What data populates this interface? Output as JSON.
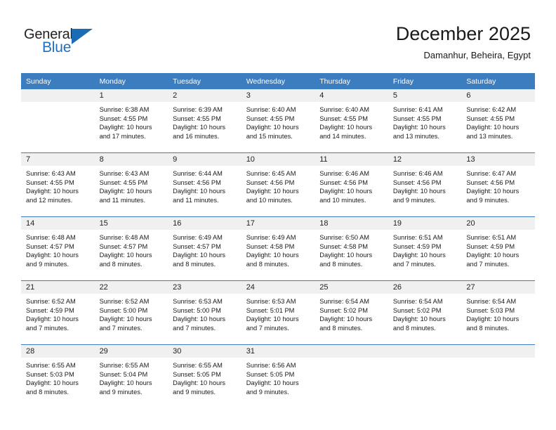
{
  "logo": {
    "word_top": "General",
    "word_bottom": "Blue",
    "accent_color": "#1a6cb5",
    "triangle_icon": "triangle-icon"
  },
  "header": {
    "title": "December 2025",
    "subtitle": "Damanhur, Beheira, Egypt"
  },
  "calendar": {
    "header_bg": "#3c7dc0",
    "daynum_bg": "#f0f0f0",
    "weekday_headers": [
      "Sunday",
      "Monday",
      "Tuesday",
      "Wednesday",
      "Thursday",
      "Friday",
      "Saturday"
    ],
    "weeks": [
      [
        {
          "day": "",
          "sunrise": "",
          "sunset": "",
          "daylight_line1": "",
          "daylight_line2": "",
          "empty": true
        },
        {
          "day": "1",
          "sunrise": "Sunrise: 6:38 AM",
          "sunset": "Sunset: 4:55 PM",
          "daylight_line1": "Daylight: 10 hours",
          "daylight_line2": "and 17 minutes.",
          "empty": false
        },
        {
          "day": "2",
          "sunrise": "Sunrise: 6:39 AM",
          "sunset": "Sunset: 4:55 PM",
          "daylight_line1": "Daylight: 10 hours",
          "daylight_line2": "and 16 minutes.",
          "empty": false
        },
        {
          "day": "3",
          "sunrise": "Sunrise: 6:40 AM",
          "sunset": "Sunset: 4:55 PM",
          "daylight_line1": "Daylight: 10 hours",
          "daylight_line2": "and 15 minutes.",
          "empty": false
        },
        {
          "day": "4",
          "sunrise": "Sunrise: 6:40 AM",
          "sunset": "Sunset: 4:55 PM",
          "daylight_line1": "Daylight: 10 hours",
          "daylight_line2": "and 14 minutes.",
          "empty": false
        },
        {
          "day": "5",
          "sunrise": "Sunrise: 6:41 AM",
          "sunset": "Sunset: 4:55 PM",
          "daylight_line1": "Daylight: 10 hours",
          "daylight_line2": "and 13 minutes.",
          "empty": false
        },
        {
          "day": "6",
          "sunrise": "Sunrise: 6:42 AM",
          "sunset": "Sunset: 4:55 PM",
          "daylight_line1": "Daylight: 10 hours",
          "daylight_line2": "and 13 minutes.",
          "empty": false
        }
      ],
      [
        {
          "day": "7",
          "sunrise": "Sunrise: 6:43 AM",
          "sunset": "Sunset: 4:55 PM",
          "daylight_line1": "Daylight: 10 hours",
          "daylight_line2": "and 12 minutes.",
          "empty": false
        },
        {
          "day": "8",
          "sunrise": "Sunrise: 6:43 AM",
          "sunset": "Sunset: 4:55 PM",
          "daylight_line1": "Daylight: 10 hours",
          "daylight_line2": "and 11 minutes.",
          "empty": false
        },
        {
          "day": "9",
          "sunrise": "Sunrise: 6:44 AM",
          "sunset": "Sunset: 4:56 PM",
          "daylight_line1": "Daylight: 10 hours",
          "daylight_line2": "and 11 minutes.",
          "empty": false
        },
        {
          "day": "10",
          "sunrise": "Sunrise: 6:45 AM",
          "sunset": "Sunset: 4:56 PM",
          "daylight_line1": "Daylight: 10 hours",
          "daylight_line2": "and 10 minutes.",
          "empty": false
        },
        {
          "day": "11",
          "sunrise": "Sunrise: 6:46 AM",
          "sunset": "Sunset: 4:56 PM",
          "daylight_line1": "Daylight: 10 hours",
          "daylight_line2": "and 10 minutes.",
          "empty": false
        },
        {
          "day": "12",
          "sunrise": "Sunrise: 6:46 AM",
          "sunset": "Sunset: 4:56 PM",
          "daylight_line1": "Daylight: 10 hours",
          "daylight_line2": "and 9 minutes.",
          "empty": false
        },
        {
          "day": "13",
          "sunrise": "Sunrise: 6:47 AM",
          "sunset": "Sunset: 4:56 PM",
          "daylight_line1": "Daylight: 10 hours",
          "daylight_line2": "and 9 minutes.",
          "empty": false
        }
      ],
      [
        {
          "day": "14",
          "sunrise": "Sunrise: 6:48 AM",
          "sunset": "Sunset: 4:57 PM",
          "daylight_line1": "Daylight: 10 hours",
          "daylight_line2": "and 9 minutes.",
          "empty": false
        },
        {
          "day": "15",
          "sunrise": "Sunrise: 6:48 AM",
          "sunset": "Sunset: 4:57 PM",
          "daylight_line1": "Daylight: 10 hours",
          "daylight_line2": "and 8 minutes.",
          "empty": false
        },
        {
          "day": "16",
          "sunrise": "Sunrise: 6:49 AM",
          "sunset": "Sunset: 4:57 PM",
          "daylight_line1": "Daylight: 10 hours",
          "daylight_line2": "and 8 minutes.",
          "empty": false
        },
        {
          "day": "17",
          "sunrise": "Sunrise: 6:49 AM",
          "sunset": "Sunset: 4:58 PM",
          "daylight_line1": "Daylight: 10 hours",
          "daylight_line2": "and 8 minutes.",
          "empty": false
        },
        {
          "day": "18",
          "sunrise": "Sunrise: 6:50 AM",
          "sunset": "Sunset: 4:58 PM",
          "daylight_line1": "Daylight: 10 hours",
          "daylight_line2": "and 8 minutes.",
          "empty": false
        },
        {
          "day": "19",
          "sunrise": "Sunrise: 6:51 AM",
          "sunset": "Sunset: 4:59 PM",
          "daylight_line1": "Daylight: 10 hours",
          "daylight_line2": "and 7 minutes.",
          "empty": false
        },
        {
          "day": "20",
          "sunrise": "Sunrise: 6:51 AM",
          "sunset": "Sunset: 4:59 PM",
          "daylight_line1": "Daylight: 10 hours",
          "daylight_line2": "and 7 minutes.",
          "empty": false
        }
      ],
      [
        {
          "day": "21",
          "sunrise": "Sunrise: 6:52 AM",
          "sunset": "Sunset: 4:59 PM",
          "daylight_line1": "Daylight: 10 hours",
          "daylight_line2": "and 7 minutes.",
          "empty": false
        },
        {
          "day": "22",
          "sunrise": "Sunrise: 6:52 AM",
          "sunset": "Sunset: 5:00 PM",
          "daylight_line1": "Daylight: 10 hours",
          "daylight_line2": "and 7 minutes.",
          "empty": false
        },
        {
          "day": "23",
          "sunrise": "Sunrise: 6:53 AM",
          "sunset": "Sunset: 5:00 PM",
          "daylight_line1": "Daylight: 10 hours",
          "daylight_line2": "and 7 minutes.",
          "empty": false
        },
        {
          "day": "24",
          "sunrise": "Sunrise: 6:53 AM",
          "sunset": "Sunset: 5:01 PM",
          "daylight_line1": "Daylight: 10 hours",
          "daylight_line2": "and 7 minutes.",
          "empty": false
        },
        {
          "day": "25",
          "sunrise": "Sunrise: 6:54 AM",
          "sunset": "Sunset: 5:02 PM",
          "daylight_line1": "Daylight: 10 hours",
          "daylight_line2": "and 8 minutes.",
          "empty": false
        },
        {
          "day": "26",
          "sunrise": "Sunrise: 6:54 AM",
          "sunset": "Sunset: 5:02 PM",
          "daylight_line1": "Daylight: 10 hours",
          "daylight_line2": "and 8 minutes.",
          "empty": false
        },
        {
          "day": "27",
          "sunrise": "Sunrise: 6:54 AM",
          "sunset": "Sunset: 5:03 PM",
          "daylight_line1": "Daylight: 10 hours",
          "daylight_line2": "and 8 minutes.",
          "empty": false
        }
      ],
      [
        {
          "day": "28",
          "sunrise": "Sunrise: 6:55 AM",
          "sunset": "Sunset: 5:03 PM",
          "daylight_line1": "Daylight: 10 hours",
          "daylight_line2": "and 8 minutes.",
          "empty": false
        },
        {
          "day": "29",
          "sunrise": "Sunrise: 6:55 AM",
          "sunset": "Sunset: 5:04 PM",
          "daylight_line1": "Daylight: 10 hours",
          "daylight_line2": "and 9 minutes.",
          "empty": false
        },
        {
          "day": "30",
          "sunrise": "Sunrise: 6:55 AM",
          "sunset": "Sunset: 5:05 PM",
          "daylight_line1": "Daylight: 10 hours",
          "daylight_line2": "and 9 minutes.",
          "empty": false
        },
        {
          "day": "31",
          "sunrise": "Sunrise: 6:56 AM",
          "sunset": "Sunset: 5:05 PM",
          "daylight_line1": "Daylight: 10 hours",
          "daylight_line2": "and 9 minutes.",
          "empty": false
        },
        {
          "day": "",
          "sunrise": "",
          "sunset": "",
          "daylight_line1": "",
          "daylight_line2": "",
          "empty": true
        },
        {
          "day": "",
          "sunrise": "",
          "sunset": "",
          "daylight_line1": "",
          "daylight_line2": "",
          "empty": true
        },
        {
          "day": "",
          "sunrise": "",
          "sunset": "",
          "daylight_line1": "",
          "daylight_line2": "",
          "empty": true
        }
      ]
    ]
  }
}
